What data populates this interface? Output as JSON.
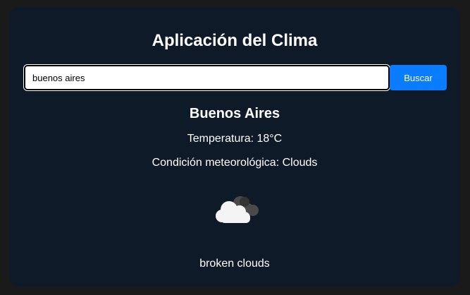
{
  "app": {
    "title": "Aplicación del Clima"
  },
  "search": {
    "value": "buenos aires",
    "button_label": "Buscar"
  },
  "weather": {
    "city": "Buenos Aires",
    "temperature": "Temperatura: 18°C",
    "condition": "Condición meteorológica: Clouds",
    "description": "broken clouds",
    "icon": "broken-clouds-icon"
  },
  "colors": {
    "background": "#1a1a1a",
    "card": "#0f1a29",
    "accent": "#0a7cff",
    "text": "#ffffff"
  }
}
